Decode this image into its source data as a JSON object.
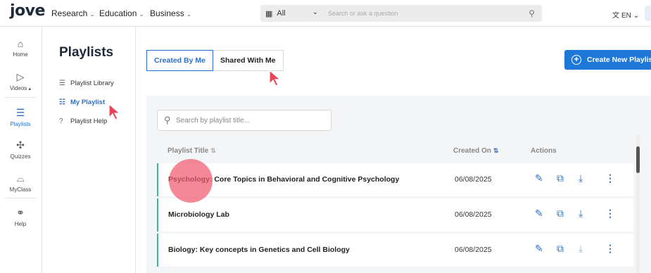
{
  "topbar": {
    "logo": "jove",
    "nav": [
      {
        "label": "Research"
      },
      {
        "label": "Education"
      },
      {
        "label": "Business"
      }
    ],
    "search": {
      "filter_value": "All",
      "placeholder": "Search or ask a question"
    },
    "language": "EN"
  },
  "rail": {
    "items": [
      {
        "label": "Home",
        "icon": "home-icon"
      },
      {
        "label": "Videos",
        "icon": "video-icon"
      },
      {
        "label": "Playlists",
        "icon": "playlist-icon",
        "active": true
      },
      {
        "label": "Quizzes",
        "icon": "puzzle-icon"
      },
      {
        "label": "MyClass",
        "icon": "graduation-cap-icon"
      },
      {
        "label": "Help",
        "icon": "link-icon"
      }
    ]
  },
  "sidebar": {
    "title": "Playlists",
    "items": [
      {
        "label": "Playlist Library",
        "icon": "library-icon"
      },
      {
        "label": "My Playlist",
        "icon": "list-icon",
        "active": true
      },
      {
        "label": "Playlist Help",
        "icon": "help-circle-icon"
      }
    ]
  },
  "tabs": [
    {
      "label": "Created By Me",
      "active": true
    },
    {
      "label": "Shared With Me"
    }
  ],
  "create_button": {
    "label": "Create New Playlist"
  },
  "playlist_search": {
    "placeholder": "Search by playlist title..."
  },
  "table": {
    "headers": {
      "title": "Playlist Title",
      "created_on": "Created On",
      "actions": "Actions"
    },
    "rows": [
      {
        "title": "Psychology: Core Topics in Behavioral and Cognitive Psychology",
        "created_on": "06/08/2025"
      },
      {
        "title": "Microbiology Lab",
        "created_on": "06/08/2025"
      },
      {
        "title": "Biology: Key concepts in Genetics and Cell Biology",
        "created_on": "06/08/2025"
      }
    ]
  },
  "colors": {
    "accent": "#2d6fc7",
    "primary_button": "#1e78d8",
    "row_marker": "#3fb59a",
    "cursor": "#e8455a"
  }
}
